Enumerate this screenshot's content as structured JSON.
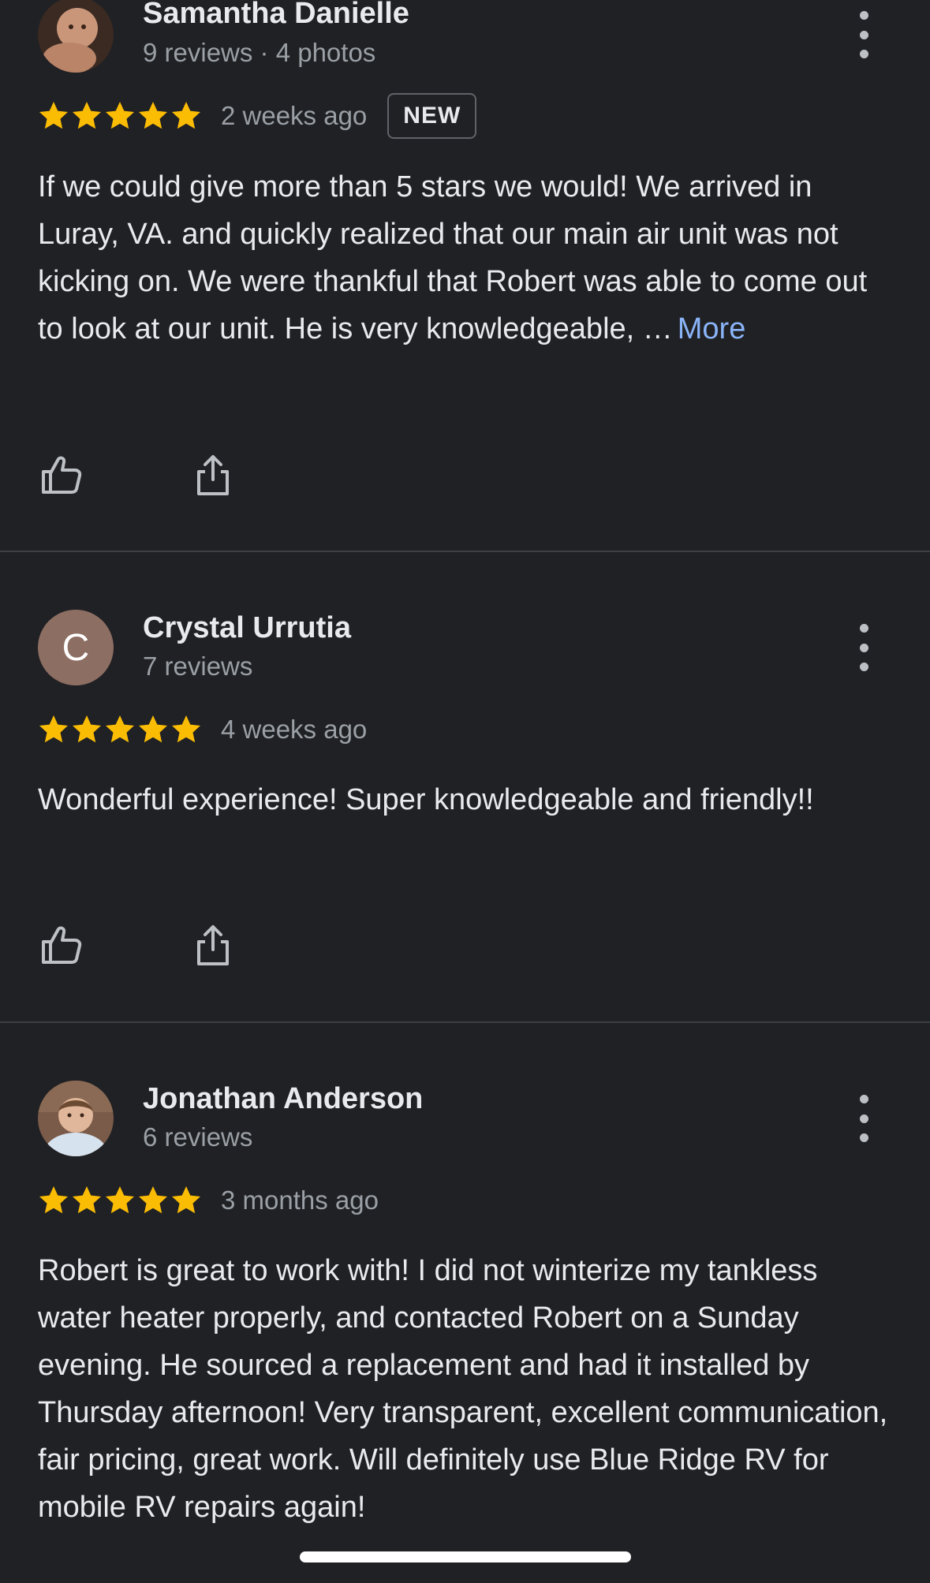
{
  "reviews": [
    {
      "name": "Samantha Danielle",
      "meta": "9 reviews · 4 photos",
      "avatar": "baby-photo",
      "rating": 5,
      "time": "2 weeks ago",
      "badge": "NEW",
      "text": "If we could give more than 5 stars we would! We arrived in Luray, VA. and quickly realized that our main air unit was not kicking on. We were thankful that Robert was able to come out to look at our unit. He is very knowledgeable, …",
      "more_label": "More"
    },
    {
      "name": "Crystal Urrutia",
      "meta": "7 reviews",
      "avatar_letter": "C",
      "rating": 5,
      "time": "4 weeks ago",
      "text": "Wonderful experience! Super knowledgeable and friendly!!"
    },
    {
      "name": "Jonathan Anderson",
      "meta": "6 reviews",
      "avatar": "man-portrait-photo",
      "rating": 5,
      "time": "3 months ago",
      "text": "Robert is great to work with! I did not winterize my tankless water heater properly, and contacted Robert on a Sunday evening. He sourced a replacement and had it installed by Thursday afternoon! Very transparent, excellent communication, fair pricing, great work. Will definitely use Blue Ridge RV for mobile RV repairs again!"
    }
  ],
  "icons": {
    "like": "thumb-up-icon",
    "share": "share-icon",
    "menu": "more-vert-icon",
    "star": "star-icon"
  },
  "colors": {
    "background": "#202124",
    "star": "#fbbc04",
    "link": "#8ab4f8",
    "secondary_text": "#9aa0a6",
    "avatar_letter_bg": "#8d6e63"
  }
}
